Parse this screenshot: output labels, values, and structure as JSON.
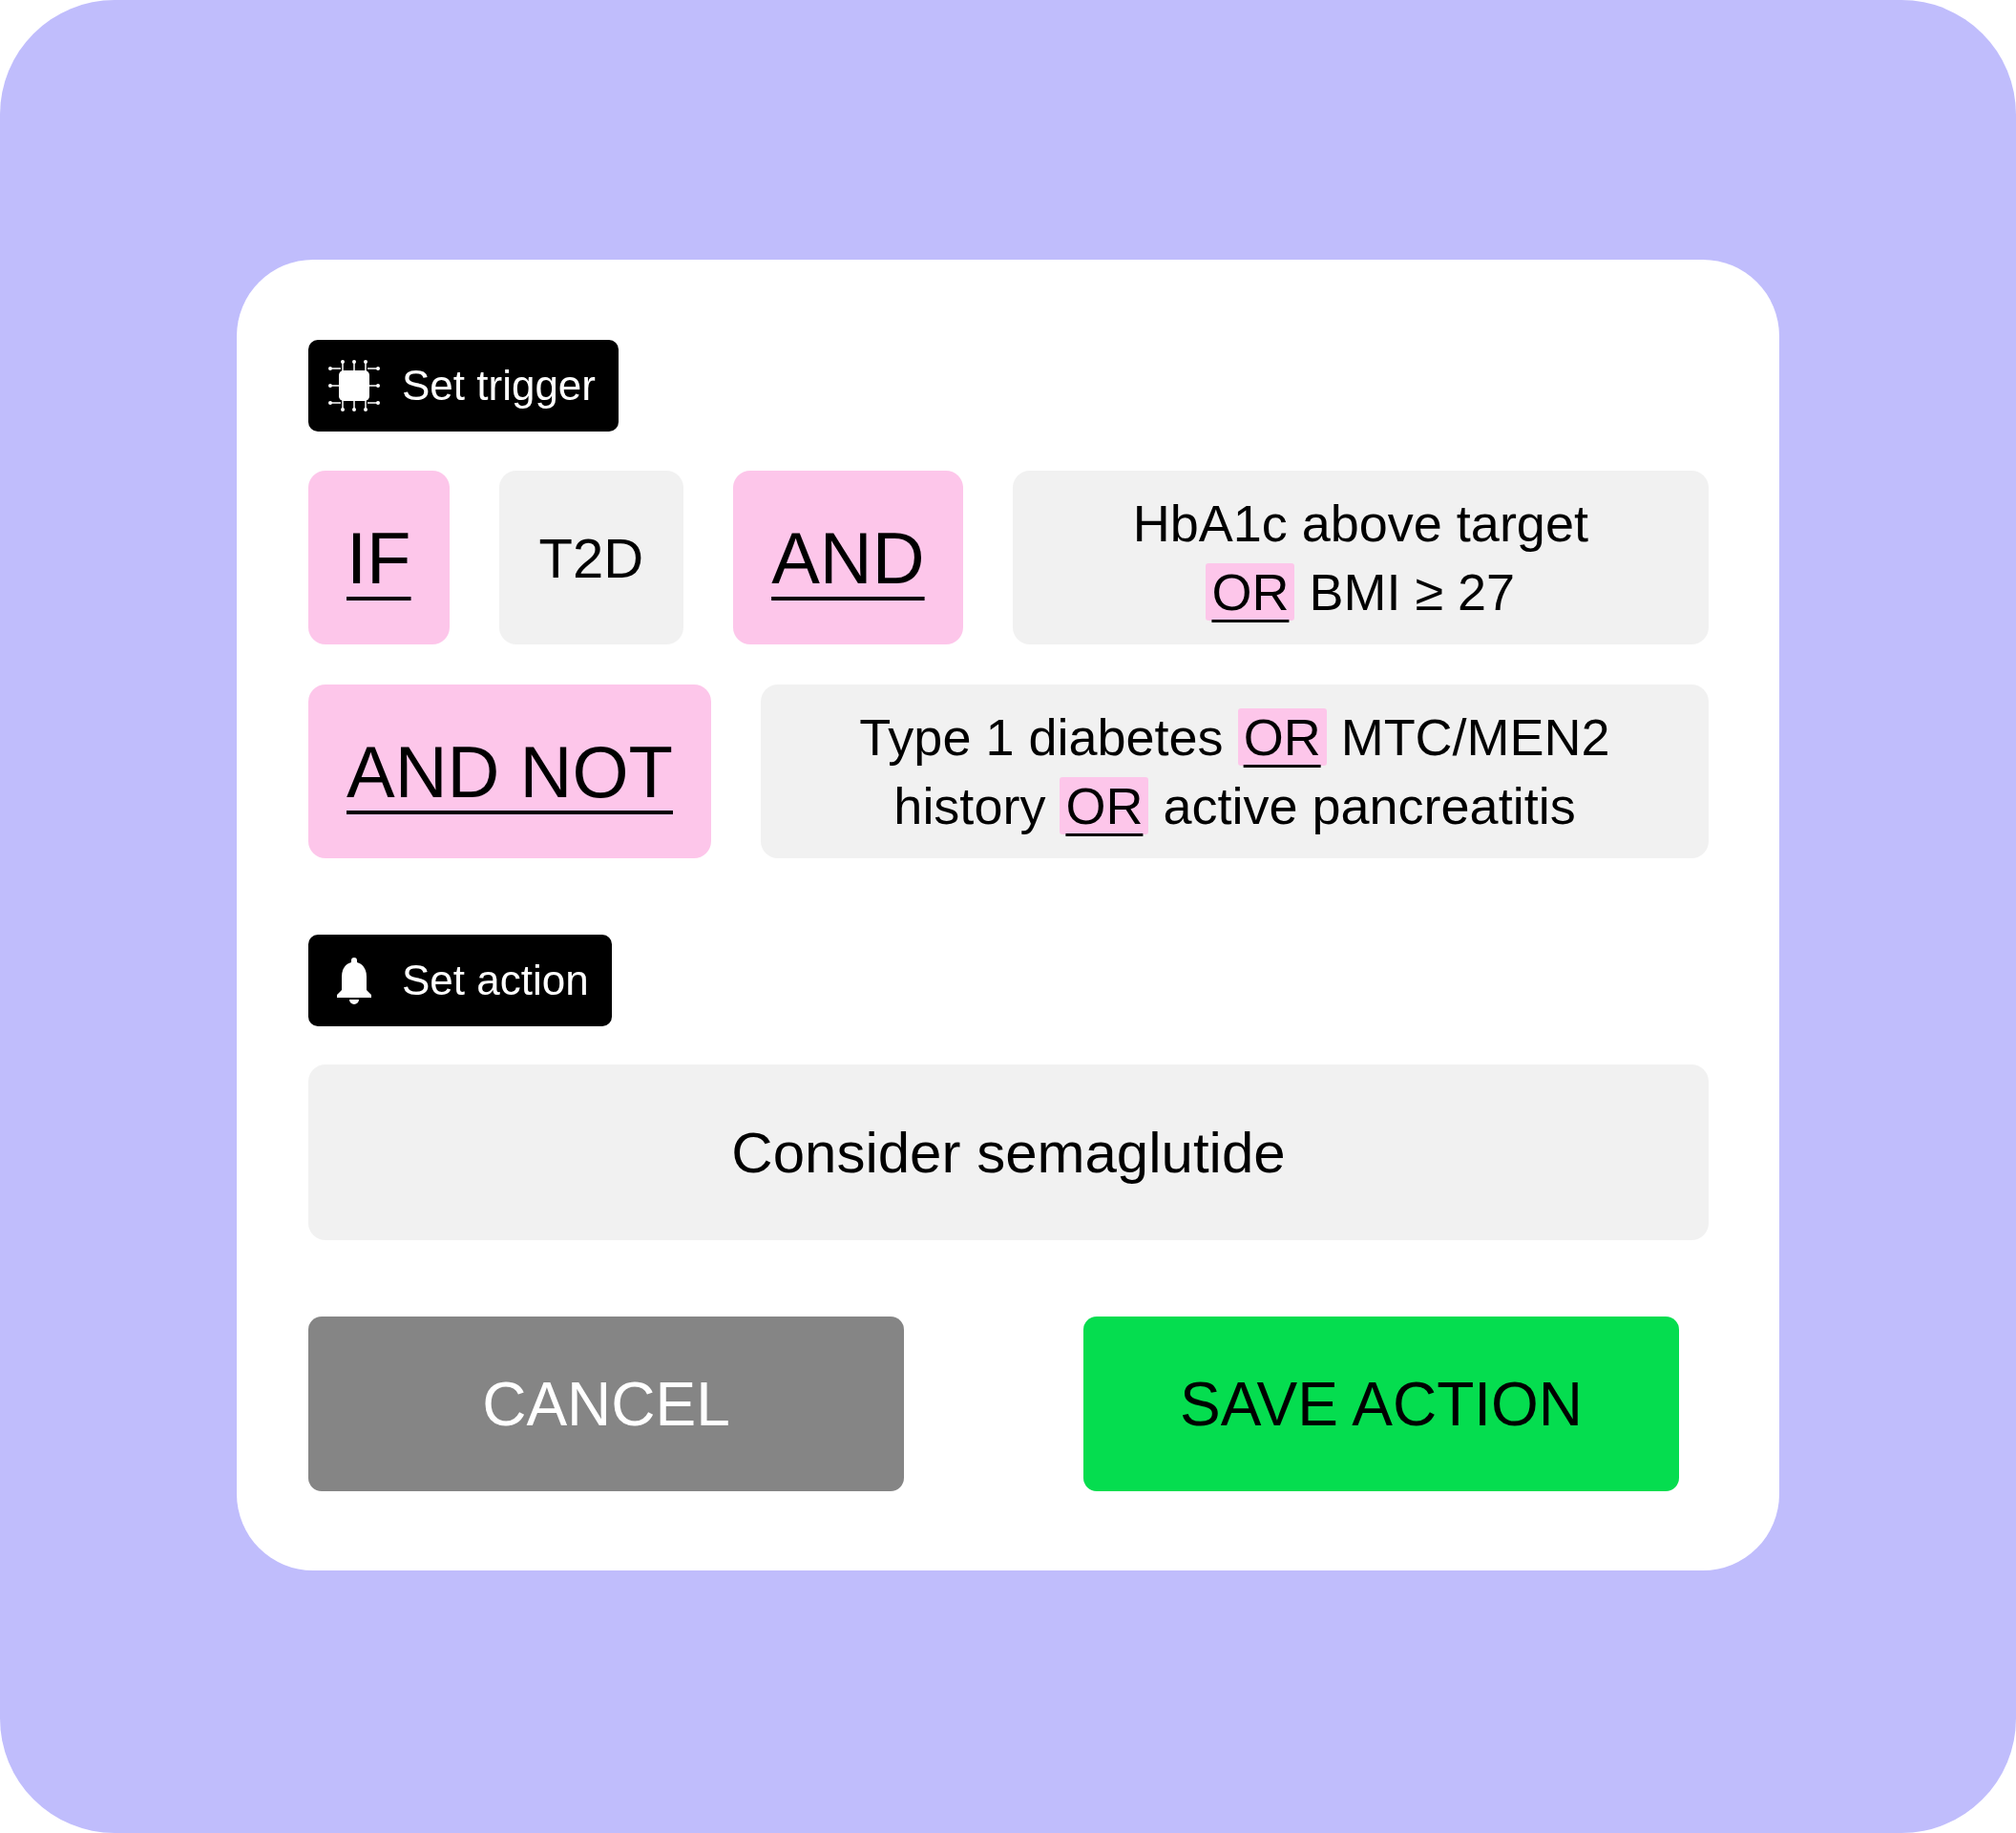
{
  "trigger_header": {
    "label": "Set trigger"
  },
  "rule_rows": [
    {
      "tokens": [
        {
          "kind": "operator",
          "text": "IF"
        },
        {
          "kind": "value",
          "text": "T2D"
        },
        {
          "kind": "operator",
          "text": "AND"
        },
        {
          "kind": "condition",
          "parts": [
            {
              "kind": "text",
              "text": "HbA1c above target"
            },
            {
              "kind": "operator",
              "text": "OR"
            },
            {
              "kind": "text",
              "text": "BMI ≥  27"
            }
          ]
        }
      ]
    },
    {
      "tokens": [
        {
          "kind": "operator",
          "text": "AND NOT"
        },
        {
          "kind": "condition",
          "parts": [
            {
              "kind": "text",
              "text": "Type 1 diabetes"
            },
            {
              "kind": "operator",
              "text": "OR"
            },
            {
              "kind": "text",
              "text": "MTC/MEN2"
            },
            {
              "kind": "text",
              "text": "history"
            },
            {
              "kind": "operator",
              "text": "OR"
            },
            {
              "kind": "text",
              "text": "active pancreatitis"
            }
          ]
        }
      ]
    }
  ],
  "action_header": {
    "label": "Set action"
  },
  "action": {
    "value": "Consider semaglutide"
  },
  "buttons": [
    {
      "kind": "secondary",
      "label": "CANCEL"
    },
    {
      "kind": "primary",
      "label": "SAVE ACTION"
    }
  ]
}
